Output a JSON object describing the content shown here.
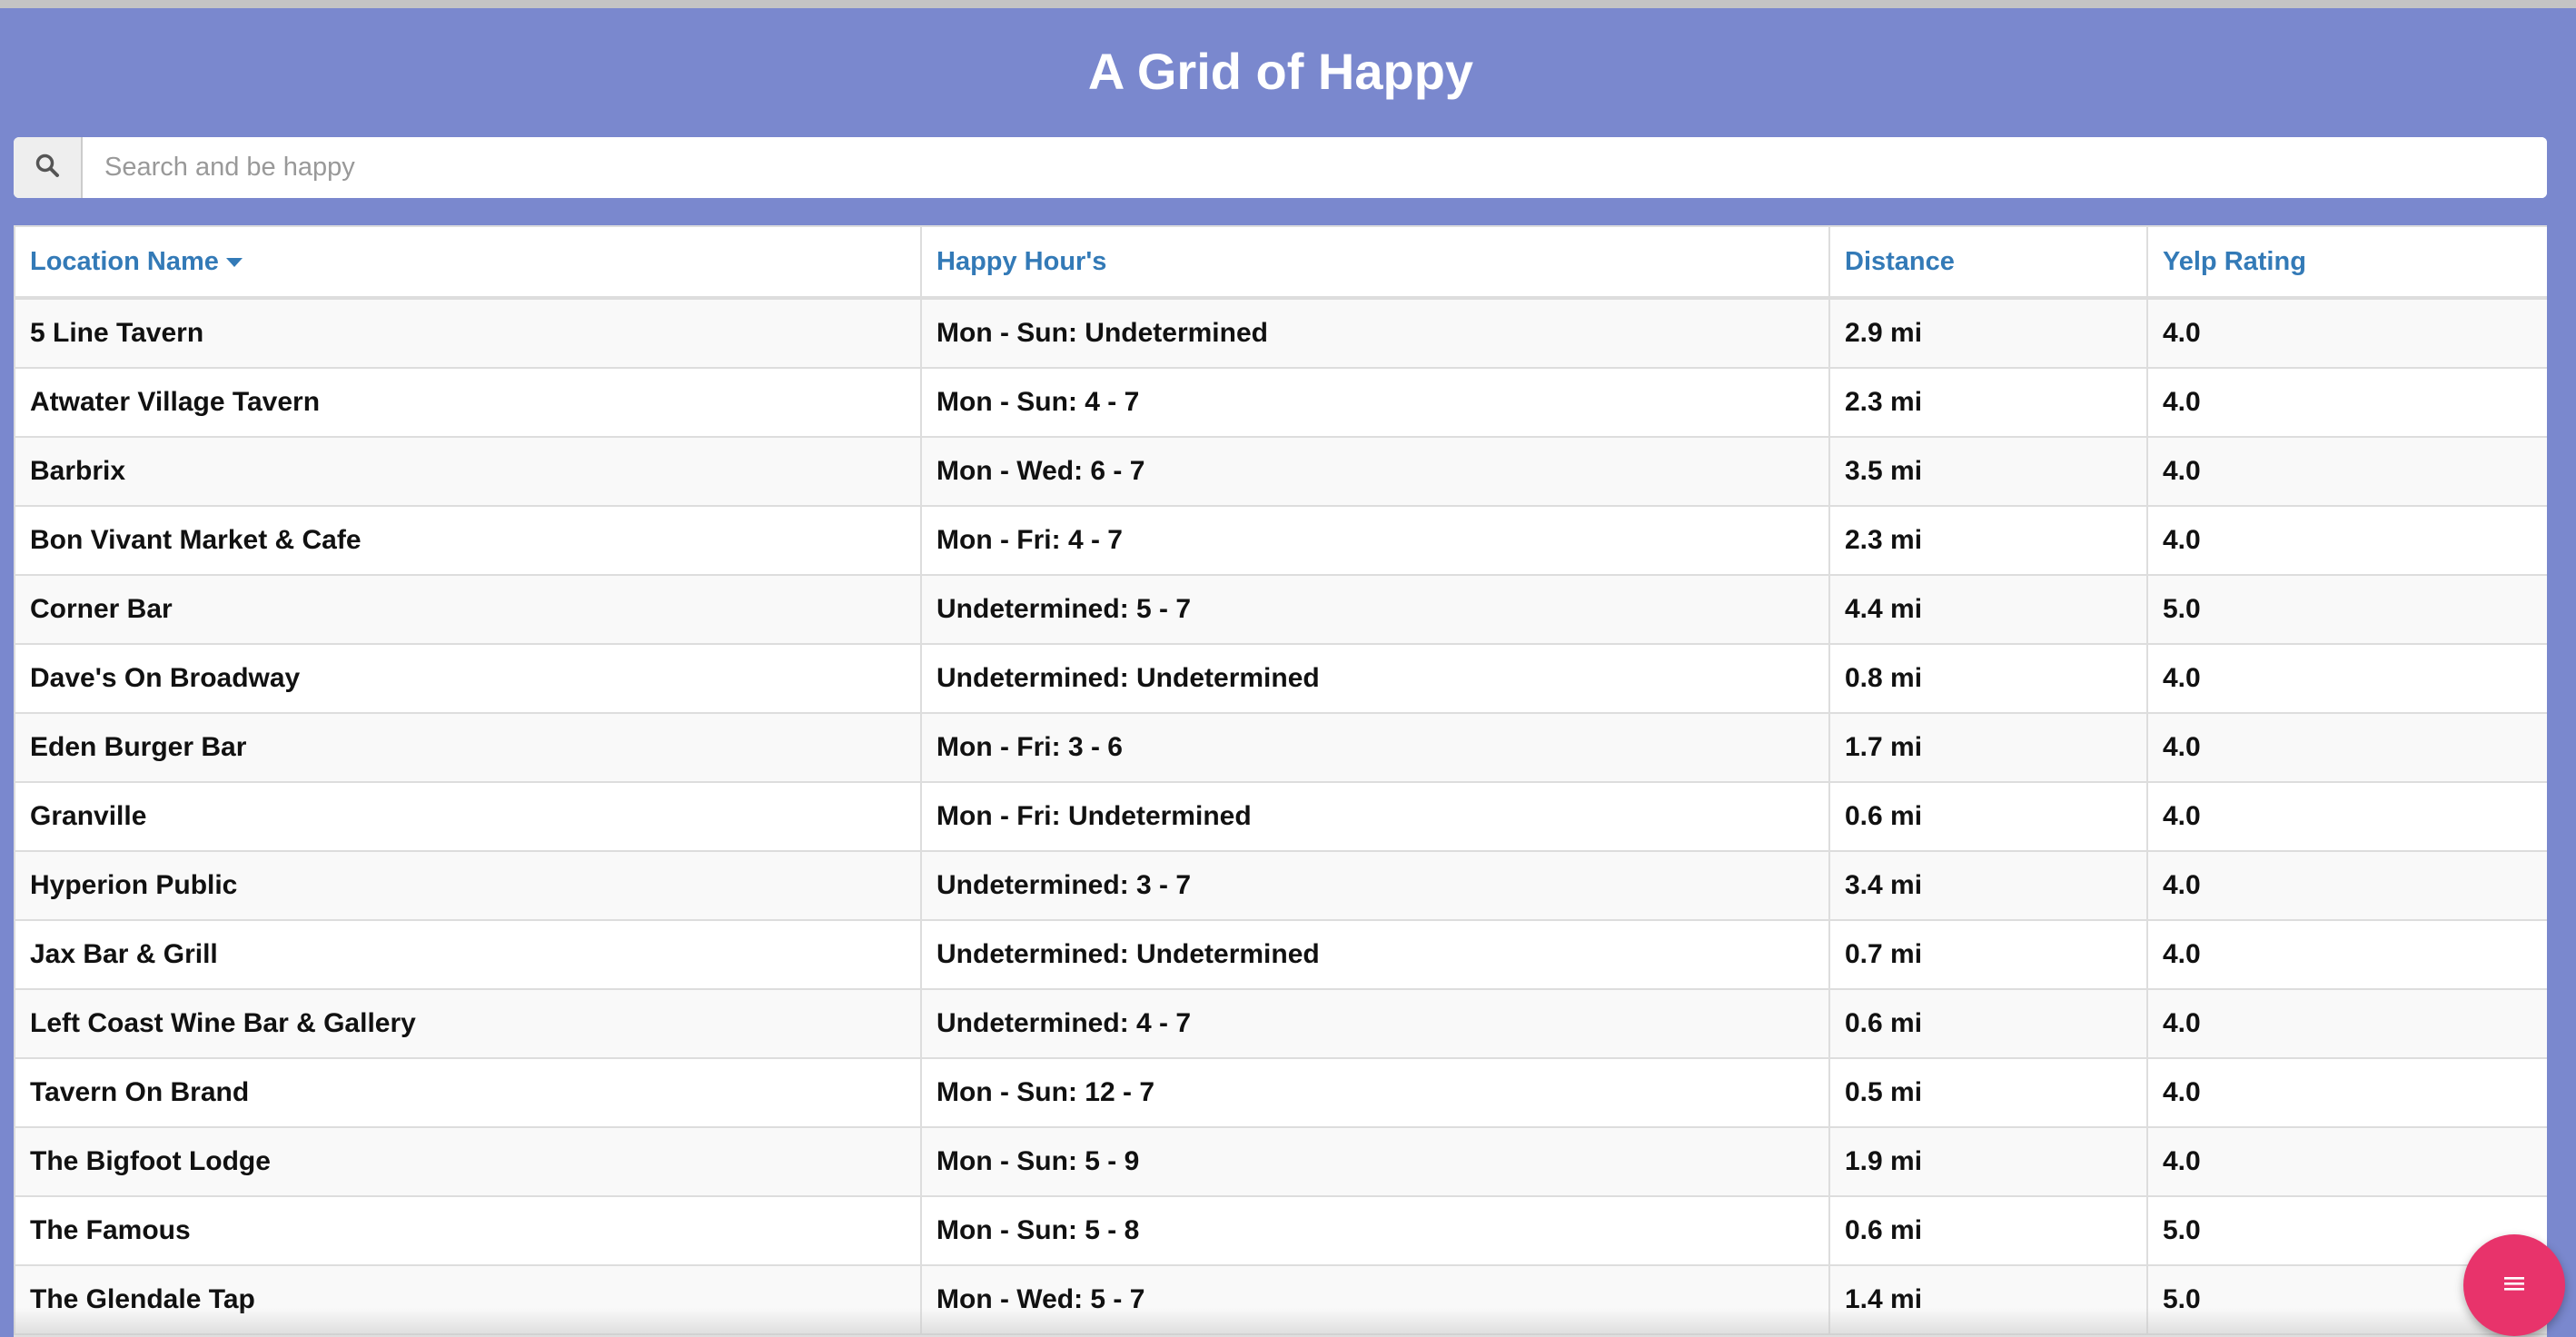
{
  "header": {
    "title": "A Grid of Happy"
  },
  "search": {
    "placeholder": "Search and be happy",
    "icon": "search-icon"
  },
  "table": {
    "columns": [
      {
        "label": "Location Name",
        "sorted": "descending"
      },
      {
        "label": "Happy Hour's"
      },
      {
        "label": "Distance"
      },
      {
        "label": "Yelp Rating"
      }
    ],
    "rows": [
      {
        "name": "5 Line Tavern",
        "hours": "Mon - Sun: Undetermined",
        "distance": "2.9 mi",
        "rating": "4.0"
      },
      {
        "name": "Atwater Village Tavern",
        "hours": "Mon - Sun: 4 - 7",
        "distance": "2.3 mi",
        "rating": "4.0"
      },
      {
        "name": "Barbrix",
        "hours": "Mon - Wed: 6 - 7",
        "distance": "3.5 mi",
        "rating": "4.0"
      },
      {
        "name": "Bon Vivant Market & Cafe",
        "hours": "Mon - Fri: 4 - 7",
        "distance": "2.3 mi",
        "rating": "4.0"
      },
      {
        "name": "Corner Bar",
        "hours": "Undetermined: 5 - 7",
        "distance": "4.4 mi",
        "rating": "5.0"
      },
      {
        "name": "Dave's On Broadway",
        "hours": "Undetermined: Undetermined",
        "distance": "0.8 mi",
        "rating": "4.0"
      },
      {
        "name": "Eden Burger Bar",
        "hours": "Mon - Fri: 3 - 6",
        "distance": "1.7 mi",
        "rating": "4.0"
      },
      {
        "name": "Granville",
        "hours": "Mon - Fri: Undetermined",
        "distance": "0.6 mi",
        "rating": "4.0"
      },
      {
        "name": "Hyperion Public",
        "hours": "Undetermined: 3 - 7",
        "distance": "3.4 mi",
        "rating": "4.0"
      },
      {
        "name": "Jax Bar & Grill",
        "hours": "Undetermined: Undetermined",
        "distance": "0.7 mi",
        "rating": "4.0"
      },
      {
        "name": "Left Coast Wine Bar & Gallery",
        "hours": "Undetermined: 4 - 7",
        "distance": "0.6 mi",
        "rating": "4.0"
      },
      {
        "name": "Tavern On Brand",
        "hours": "Mon - Sun: 12 - 7",
        "distance": "0.5 mi",
        "rating": "4.0"
      },
      {
        "name": "The Bigfoot Lodge",
        "hours": "Mon - Sun: 5 - 9",
        "distance": "1.9 mi",
        "rating": "4.0"
      },
      {
        "name": "The Famous",
        "hours": "Mon - Sun: 5 - 8",
        "distance": "0.6 mi",
        "rating": "5.0"
      },
      {
        "name": "The Glendale Tap",
        "hours": "Mon - Wed: 5 - 7",
        "distance": "1.4 mi",
        "rating": "5.0"
      }
    ]
  },
  "fab": {
    "icon": "menu-icon",
    "color": "#e8336b"
  },
  "colors": {
    "background": "#7a88ce",
    "header_link": "#337ab7"
  }
}
